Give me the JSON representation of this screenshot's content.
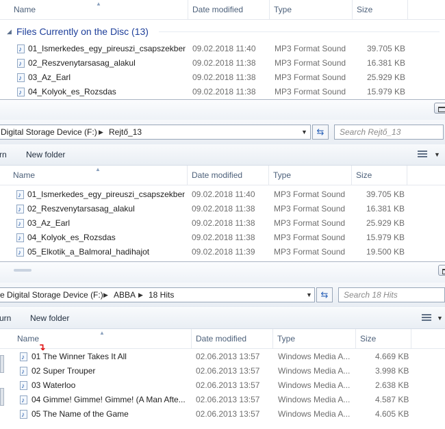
{
  "columns": {
    "name": "Name",
    "date": "Date modified",
    "type": "Type",
    "size": "Size"
  },
  "window1": {
    "group_title": "Files Currently on the Disc (13)",
    "files": [
      {
        "name": "01_Ismerkedes_egy_pireuszi_csapszekben",
        "date": "09.02.2018 11:40",
        "type": "MP3 Format Sound",
        "size": "39.705 KB"
      },
      {
        "name": "02_Reszvenytarsasag_alakul",
        "date": "09.02.2018 11:38",
        "type": "MP3 Format Sound",
        "size": "16.381 KB"
      },
      {
        "name": "03_Az_Earl",
        "date": "09.02.2018 11:38",
        "type": "MP3 Format Sound",
        "size": "25.929 KB"
      },
      {
        "name": "04_Kolyok_es_Rozsdas",
        "date": "09.02.2018 11:38",
        "type": "MP3 Format Sound",
        "size": "15.979 KB"
      }
    ]
  },
  "window2": {
    "breadcrumb": [
      "Digital Storage Device (F:)",
      "Rejtő_13"
    ],
    "search_placeholder": "Search Rejtő_13",
    "toolbar": {
      "partial": "rn",
      "new_folder": "New folder"
    },
    "files": [
      {
        "name": "01_Ismerkedes_egy_pireuszi_csapszekben",
        "date": "09.02.2018 11:40",
        "type": "MP3 Format Sound",
        "size": "39.705 KB"
      },
      {
        "name": "02_Reszvenytarsasag_alakul",
        "date": "09.02.2018 11:38",
        "type": "MP3 Format Sound",
        "size": "16.381 KB"
      },
      {
        "name": "03_Az_Earl",
        "date": "09.02.2018 11:38",
        "type": "MP3 Format Sound",
        "size": "25.929 KB"
      },
      {
        "name": "04_Kolyok_es_Rozsdas",
        "date": "09.02.2018 11:38",
        "type": "MP3 Format Sound",
        "size": "15.979 KB"
      },
      {
        "name": "05_Elkotik_a_Balmoral_hadihajot",
        "date": "09.02.2018 11:39",
        "type": "MP3 Format Sound",
        "size": "19.500 KB"
      }
    ]
  },
  "window3": {
    "breadcrumb": [
      "e Digital Storage Device (F:)",
      "ABBA",
      "18 Hits"
    ],
    "search_placeholder": "Search 18 Hits",
    "toolbar": {
      "partial": "urn",
      "new_folder": "New folder"
    },
    "files": [
      {
        "name": "01 The Winner Takes It All",
        "date": "02.06.2013 13:57",
        "type": "Windows Media A...",
        "size": "4.669 KB"
      },
      {
        "name": "02 Super Trouper",
        "date": "02.06.2013 13:57",
        "type": "Windows Media A...",
        "size": "3.998 KB"
      },
      {
        "name": "03 Waterloo",
        "date": "02.06.2013 13:57",
        "type": "Windows Media A...",
        "size": "2.638 KB"
      },
      {
        "name": "04 Gimme! Gimme! Gimme! (A Man Afte...",
        "date": "02.06.2013 13:57",
        "type": "Windows Media A...",
        "size": "4.587 KB"
      },
      {
        "name": "05 The Name of the Game",
        "date": "02.06.2013 13:57",
        "type": "Windows Media A...",
        "size": "4.605 KB"
      }
    ]
  },
  "colors": {
    "group_title": "#1e3f9a",
    "header_text": "#4c607a",
    "cursor": "#e01010"
  }
}
